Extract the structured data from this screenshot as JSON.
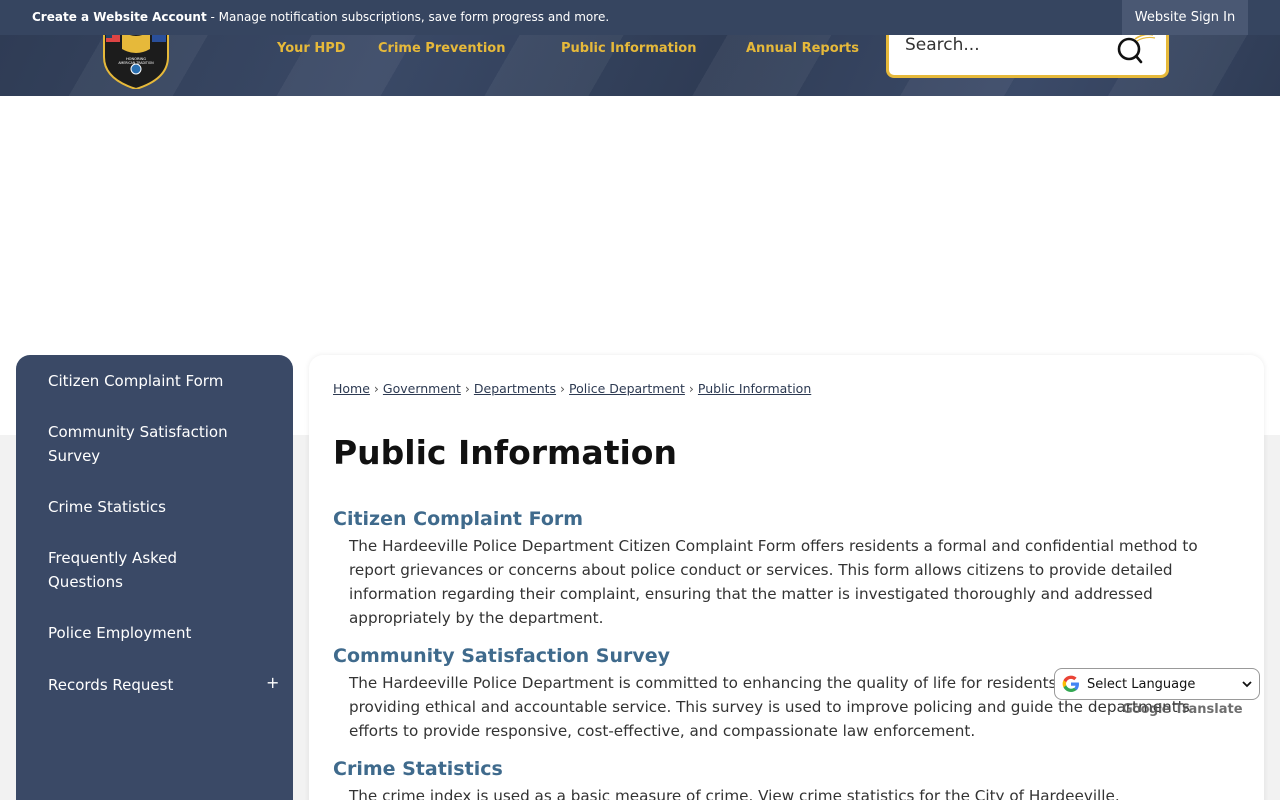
{
  "topbar": {
    "account_link": "Create a Website Account",
    "account_desc": " - Manage notification subscriptions, save form progress and more.",
    "signin": "Website Sign In"
  },
  "header": {
    "logo_text": "HONORING AMERICAN TRADITION",
    "nav": [
      "Your HPD",
      "Crime Prevention",
      "Public Information",
      "Annual Reports"
    ],
    "search_placeholder": "Search..."
  },
  "sidebar": {
    "items": [
      {
        "label": "Citizen Complaint Form"
      },
      {
        "label": "Community Satisfaction Survey"
      },
      {
        "label": "Crime Statistics"
      },
      {
        "label": "Frequently Asked Questions"
      },
      {
        "label": "Police Employment"
      },
      {
        "label": "Records Request",
        "expand": "+"
      }
    ]
  },
  "breadcrumb": [
    "Home",
    "Government",
    "Departments",
    "Police Department",
    "Public Information"
  ],
  "page_title": "Public Information",
  "sections": [
    {
      "title": "Citizen Complaint Form",
      "body": "The Hardeeville Police Department Citizen Complaint Form offers residents a formal and confidential method to report grievances or concerns about police conduct or services. This form allows citizens to provide detailed information regarding their complaint, ensuring that the matter is investigated thoroughly and addressed appropriately by the department."
    },
    {
      "title": "Community Satisfaction Survey",
      "body": "The Hardeeville Police Department is committed to enhancing the quality of life for residents and visitors by providing ethical and accountable service. This survey is used to improve policing and guide the department's efforts to provide responsive, cost-effective, and compassionate law enforcement."
    },
    {
      "title": "Crime Statistics",
      "body": "The crime index is used as a basic measure of crime. View crime statistics for the City of Hardeeville."
    }
  ],
  "translate": {
    "select_label": "Select Language",
    "powered_prefix": "Google",
    "powered_label": "Translate"
  },
  "colors": {
    "navy": "#364560",
    "gold": "#e6b93a",
    "link_blue": "#3f6a8c"
  }
}
